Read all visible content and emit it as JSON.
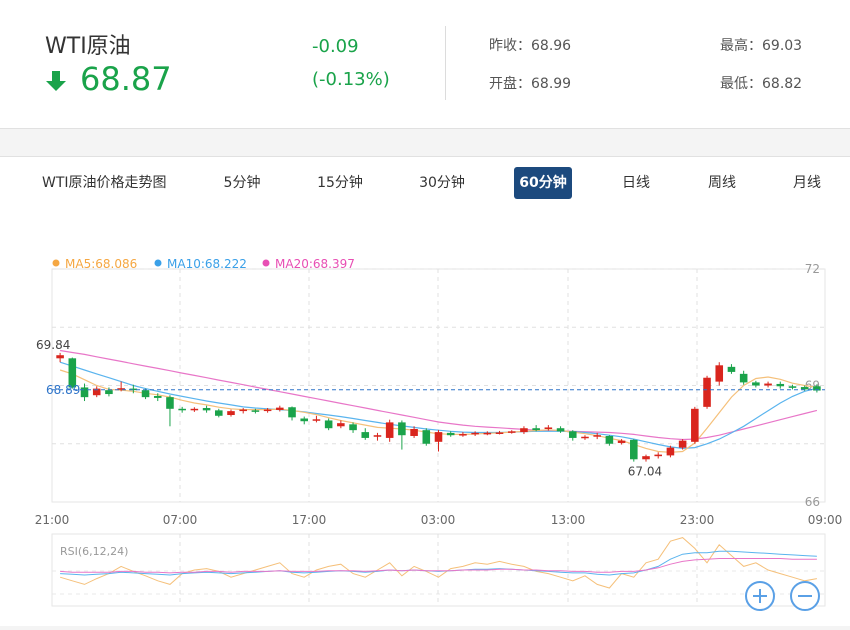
{
  "quote": {
    "name": "WTI原油",
    "price": "68.87",
    "change": "-0.09",
    "change_pct": "(-0.13%)",
    "prev_close_label": "昨收：",
    "prev_close": "68.96",
    "open_label": "开盘：",
    "open": "68.99",
    "high_label": "最高：",
    "high": "69.03",
    "low_label": "最低：",
    "low": "68.82",
    "down_color": "#1aa34a",
    "up_color": "#d9251d"
  },
  "tabs": {
    "title": "WTI原油价格走势图",
    "items": [
      "5分钟",
      "15分钟",
      "30分钟",
      "60分钟",
      "日线",
      "周线",
      "月线"
    ],
    "active": "60分钟"
  },
  "chart_data": {
    "type": "candlestick",
    "ma_legend": [
      {
        "label": "MA5:68.086",
        "color": "#f5a742"
      },
      {
        "label": "MA10:68.222",
        "color": "#3aa0e8"
      },
      {
        "label": "MA20:68.397",
        "color": "#e84fb4"
      }
    ],
    "y_ticks": [
      "72",
      "69",
      "66"
    ],
    "ylim": [
      66,
      72
    ],
    "x_ticks": [
      "21:00",
      "07:00",
      "17:00",
      "03:00",
      "13:00",
      "23:00",
      "09:00"
    ],
    "current_price_label": "68.89",
    "current_price": 68.89,
    "max_label": "69.84",
    "min_label": "67.04",
    "candles": [
      [
        69.7,
        69.78,
        69.84,
        69.6
      ],
      [
        69.7,
        68.95,
        69.72,
        68.92
      ],
      [
        68.95,
        68.7,
        69.05,
        68.6
      ],
      [
        68.75,
        68.92,
        68.98,
        68.7
      ],
      [
        68.88,
        68.78,
        68.95,
        68.72
      ],
      [
        68.9,
        68.93,
        69.1,
        68.85
      ],
      [
        68.92,
        68.88,
        69.02,
        68.8
      ],
      [
        68.88,
        68.7,
        68.92,
        68.65
      ],
      [
        68.73,
        68.68,
        68.8,
        68.6
      ],
      [
        68.7,
        68.4,
        68.75,
        67.95
      ],
      [
        68.4,
        68.38,
        68.45,
        68.3
      ],
      [
        68.38,
        68.4,
        68.44,
        68.32
      ],
      [
        68.42,
        68.36,
        68.48,
        68.3
      ],
      [
        68.36,
        68.22,
        68.4,
        68.18
      ],
      [
        68.24,
        68.34,
        68.38,
        68.2
      ],
      [
        68.35,
        68.38,
        68.42,
        68.28
      ],
      [
        68.36,
        68.33,
        68.4,
        68.28
      ],
      [
        68.35,
        68.38,
        68.42,
        68.3
      ],
      [
        68.37,
        68.43,
        68.48,
        68.33
      ],
      [
        68.44,
        68.18,
        68.46,
        68.1
      ],
      [
        68.15,
        68.08,
        68.2,
        68.0
      ],
      [
        68.1,
        68.13,
        68.22,
        68.05
      ],
      [
        68.1,
        67.9,
        68.15,
        67.85
      ],
      [
        67.95,
        68.03,
        68.1,
        67.9
      ],
      [
        68.0,
        67.85,
        68.05,
        67.78
      ],
      [
        67.8,
        67.65,
        67.9,
        67.6
      ],
      [
        67.68,
        67.72,
        67.78,
        67.58
      ],
      [
        67.65,
        68.05,
        68.12,
        67.55
      ],
      [
        68.05,
        67.72,
        68.1,
        67.35
      ],
      [
        67.7,
        67.88,
        67.95,
        67.65
      ],
      [
        67.85,
        67.5,
        67.9,
        67.45
      ],
      [
        67.55,
        67.8,
        67.85,
        67.3
      ],
      [
        67.78,
        67.72,
        67.82,
        67.68
      ],
      [
        67.72,
        67.75,
        67.8,
        67.68
      ],
      [
        67.75,
        67.78,
        67.82,
        67.7
      ],
      [
        67.76,
        67.78,
        67.82,
        67.72
      ],
      [
        67.78,
        67.79,
        67.83,
        67.74
      ],
      [
        67.8,
        67.82,
        67.85,
        67.76
      ],
      [
        67.8,
        67.9,
        67.95,
        67.75
      ],
      [
        67.9,
        67.85,
        67.98,
        67.82
      ],
      [
        67.88,
        67.92,
        67.98,
        67.84
      ],
      [
        67.9,
        67.82,
        67.95,
        67.78
      ],
      [
        67.82,
        67.65,
        67.85,
        67.58
      ],
      [
        67.65,
        67.68,
        67.72,
        67.6
      ],
      [
        67.7,
        67.72,
        67.78,
        67.62
      ],
      [
        67.7,
        67.5,
        67.72,
        67.45
      ],
      [
        67.52,
        67.58,
        67.62,
        67.48
      ],
      [
        67.6,
        67.1,
        67.62,
        67.04
      ],
      [
        67.1,
        67.18,
        67.22,
        67.04
      ],
      [
        67.18,
        67.22,
        67.28,
        67.12
      ],
      [
        67.2,
        67.4,
        67.45,
        67.15
      ],
      [
        67.4,
        67.58,
        67.62,
        67.35
      ],
      [
        67.55,
        68.4,
        68.45,
        67.5
      ],
      [
        68.45,
        69.2,
        69.25,
        68.4
      ],
      [
        69.1,
        69.52,
        69.6,
        69.0
      ],
      [
        69.48,
        69.35,
        69.55,
        69.3
      ],
      [
        69.3,
        69.08,
        69.38,
        69.02
      ],
      [
        69.08,
        69.0,
        69.12,
        68.95
      ],
      [
        69.0,
        69.05,
        69.1,
        68.95
      ],
      [
        69.04,
        68.98,
        69.1,
        68.92
      ],
      [
        68.98,
        68.94,
        69.02,
        68.9
      ],
      [
        68.96,
        68.9,
        69.0,
        68.86
      ],
      [
        68.98,
        68.87,
        69.03,
        68.82
      ]
    ],
    "ma5": [
      69.4,
      69.3,
      69.15,
      69.0,
      68.9,
      68.88,
      68.85,
      68.8,
      68.76,
      68.7,
      68.62,
      68.55,
      68.5,
      68.44,
      68.4,
      68.38,
      68.38,
      68.38,
      68.39,
      68.36,
      68.31,
      68.25,
      68.17,
      68.1,
      68.04,
      67.98,
      67.92,
      67.9,
      67.88,
      67.85,
      67.8,
      67.76,
      67.74,
      67.74,
      67.75,
      67.77,
      67.78,
      67.8,
      67.82,
      67.84,
      67.86,
      67.84,
      67.8,
      67.76,
      67.71,
      67.64,
      67.58,
      67.48,
      67.38,
      67.3,
      67.28,
      67.3,
      67.52,
      67.9,
      68.3,
      68.7,
      69.0,
      69.18,
      69.22,
      69.16,
      69.06,
      69.0,
      68.95
    ],
    "ma10": [
      69.6,
      69.5,
      69.4,
      69.3,
      69.2,
      69.1,
      69.0,
      68.92,
      68.85,
      68.78,
      68.72,
      68.66,
      68.6,
      68.55,
      68.5,
      68.45,
      68.42,
      68.4,
      68.38,
      68.35,
      68.32,
      68.28,
      68.24,
      68.2,
      68.15,
      68.1,
      68.05,
      68.0,
      67.96,
      67.92,
      67.88,
      67.85,
      67.82,
      67.8,
      67.79,
      67.79,
      67.79,
      67.8,
      67.81,
      67.82,
      67.82,
      67.82,
      67.81,
      67.79,
      67.76,
      67.72,
      67.68,
      67.62,
      67.55,
      67.48,
      67.42,
      67.38,
      67.4,
      67.5,
      67.62,
      67.78,
      67.95,
      68.15,
      68.35,
      68.55,
      68.72,
      68.85,
      68.93
    ],
    "ma20": [
      69.9,
      69.85,
      69.8,
      69.74,
      69.68,
      69.62,
      69.56,
      69.5,
      69.44,
      69.38,
      69.32,
      69.26,
      69.2,
      69.14,
      69.08,
      69.02,
      68.96,
      68.9,
      68.84,
      68.78,
      68.72,
      68.66,
      68.6,
      68.54,
      68.48,
      68.42,
      68.36,
      68.3,
      68.24,
      68.18,
      68.12,
      68.06,
      68.02,
      67.98,
      67.95,
      67.93,
      67.91,
      67.89,
      67.87,
      67.85,
      67.84,
      67.83,
      67.82,
      67.81,
      67.8,
      67.79,
      67.77,
      67.74,
      67.7,
      67.66,
      67.63,
      67.61,
      67.62,
      67.66,
      67.72,
      67.8,
      67.88,
      67.96,
      68.04,
      68.12,
      68.2,
      68.28,
      68.36
    ]
  },
  "rsi": {
    "label": "RSI(6,12,24)",
    "series": [
      {
        "color": "#f5c07a",
        "values": [
          40,
          35,
          30,
          38,
          45,
          55,
          48,
          42,
          35,
          30,
          45,
          50,
          52,
          48,
          40,
          45,
          50,
          55,
          60,
          45,
          40,
          50,
          55,
          58,
          45,
          40,
          50,
          60,
          42,
          55,
          48,
          40,
          52,
          55,
          60,
          58,
          62,
          58,
          55,
          48,
          45,
          40,
          35,
          42,
          30,
          25,
          45,
          40,
          60,
          65,
          90,
          95,
          80,
          60,
          85,
          70,
          55,
          60,
          50,
          45,
          40,
          35,
          38
        ]
      },
      {
        "color": "#5ab4ee",
        "values": [
          45,
          44,
          43,
          44,
          45,
          47,
          46,
          45,
          44,
          43,
          45,
          46,
          47,
          46,
          45,
          46,
          47,
          48,
          49,
          47,
          46,
          47,
          48,
          49,
          48,
          47,
          48,
          50,
          49,
          50,
          49,
          48,
          49,
          50,
          51,
          51,
          52,
          51,
          50,
          49,
          48,
          47,
          46,
          46,
          44,
          43,
          45,
          46,
          50,
          55,
          65,
          72,
          74,
          74,
          76,
          76,
          75,
          74,
          73,
          72,
          71,
          70,
          69
        ]
      },
      {
        "color": "#e876c8",
        "values": [
          48,
          47,
          47,
          47,
          47,
          48,
          48,
          47,
          47,
          46,
          47,
          47,
          48,
          48,
          47,
          48,
          48,
          48,
          49,
          48,
          48,
          48,
          49,
          49,
          49,
          48,
          49,
          50,
          49,
          50,
          49,
          49,
          49,
          50,
          50,
          50,
          51,
          51,
          50,
          50,
          49,
          49,
          48,
          48,
          47,
          47,
          48,
          48,
          50,
          53,
          58,
          62,
          64,
          65,
          66,
          66,
          66,
          66,
          66,
          66,
          65,
          65,
          65
        ]
      }
    ]
  },
  "zoom": {
    "in_icon": "zoom-in-icon",
    "out_icon": "zoom-out-icon"
  }
}
